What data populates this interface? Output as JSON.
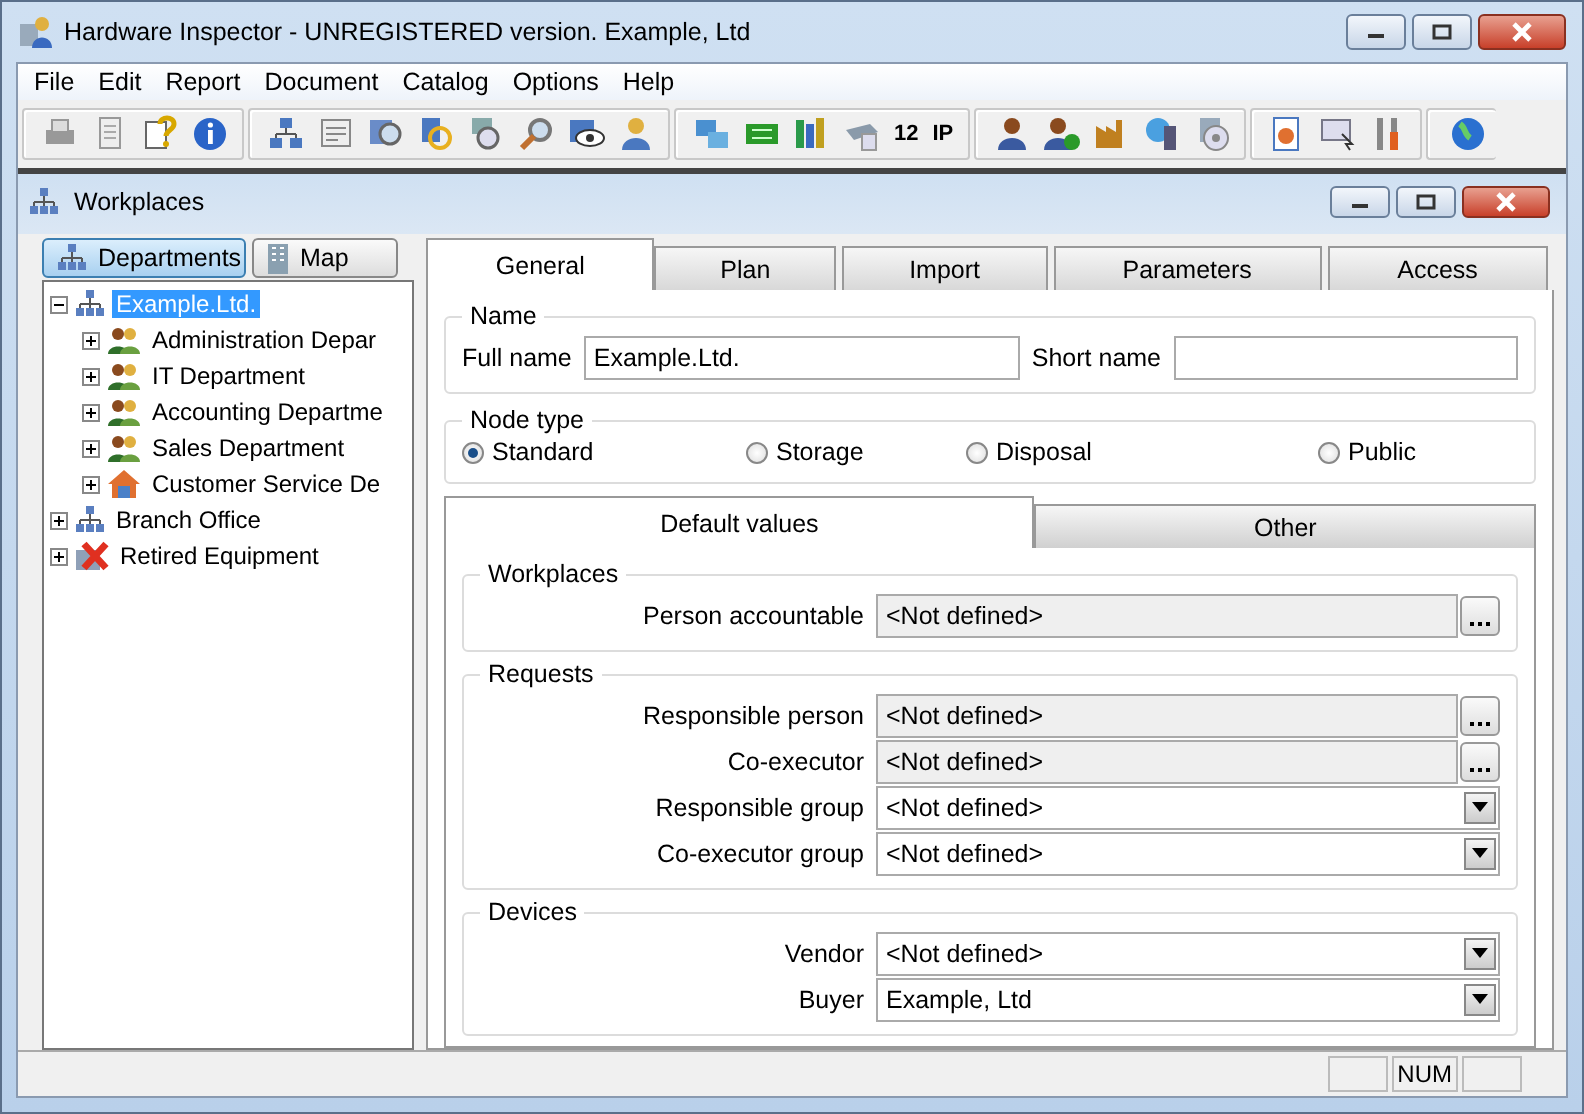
{
  "window": {
    "title": "Hardware Inspector - UNREGISTERED version. Example, Ltd"
  },
  "menu": [
    {
      "label": "File"
    },
    {
      "label": "Edit"
    },
    {
      "label": "Report"
    },
    {
      "label": "Document"
    },
    {
      "label": "Catalog"
    },
    {
      "label": "Options"
    },
    {
      "label": "Help"
    }
  ],
  "toolbar_texts": [
    "12",
    "IP"
  ],
  "child_window": {
    "title": "Workplaces"
  },
  "view_tabs": [
    {
      "label": "Departments",
      "selected": true,
      "kind": "org"
    },
    {
      "label": "Map",
      "selected": false,
      "kind": "building"
    }
  ],
  "tree": [
    {
      "label": "Example.Ltd.",
      "kind": "org",
      "selected": true,
      "expanded": true,
      "children": [
        {
          "label": "Administration Depar",
          "kind": "group",
          "selected": false,
          "expanded": false
        },
        {
          "label": "IT Department",
          "kind": "group",
          "selected": false,
          "expanded": false
        },
        {
          "label": "Accounting Departme",
          "kind": "group",
          "selected": false,
          "expanded": false
        },
        {
          "label": "Sales Department",
          "kind": "group",
          "selected": false,
          "expanded": false
        },
        {
          "label": "Customer Service De",
          "kind": "house",
          "selected": false,
          "expanded": false
        }
      ]
    },
    {
      "label": "Branch Office",
      "kind": "org",
      "selected": false,
      "expanded": false
    },
    {
      "label": "Retired Equipment",
      "kind": "retired",
      "selected": false,
      "expanded": false
    }
  ],
  "tabs": [
    {
      "label": "General",
      "selected": true
    },
    {
      "label": "Plan",
      "selected": false
    },
    {
      "label": "Import",
      "selected": false
    },
    {
      "label": "Parameters",
      "selected": false
    },
    {
      "label": "Access",
      "selected": false
    }
  ],
  "name_group": {
    "title": "Name",
    "full_name_label": "Full name",
    "full_name": "Example.Ltd.",
    "short_name_label": "Short name"
  },
  "node_type": {
    "title": "Node type",
    "options": [
      {
        "label": "Standard",
        "selected": true
      },
      {
        "label": "Storage",
        "selected": false
      },
      {
        "label": "Disposal",
        "selected": false
      },
      {
        "label": "Public",
        "selected": false
      }
    ]
  },
  "sub_tabs": [
    {
      "label": "Default values",
      "selected": true
    },
    {
      "label": "Other",
      "selected": false
    }
  ],
  "sections": [
    {
      "title": "Workplaces",
      "fields": [
        {
          "label": "Person accountable",
          "value": "<Not defined>",
          "kind": "picker"
        }
      ]
    },
    {
      "title": "Requests",
      "fields": [
        {
          "label": "Responsible person",
          "value": "<Not defined>",
          "kind": "picker"
        },
        {
          "label": "Co-executor",
          "value": "<Not defined>",
          "kind": "picker"
        },
        {
          "label": "Responsible group",
          "value": "<Not defined>",
          "kind": "dropdown"
        },
        {
          "label": "Co-executor group",
          "value": "<Not defined>",
          "kind": "dropdown"
        }
      ]
    },
    {
      "title": "Devices",
      "fields": [
        {
          "label": "Vendor",
          "value": "<Not defined>",
          "kind": "dropdown"
        },
        {
          "label": "Buyer",
          "value": "Example, Ltd",
          "kind": "dropdown"
        }
      ]
    }
  ],
  "status_bar": {
    "num": "NUM"
  }
}
